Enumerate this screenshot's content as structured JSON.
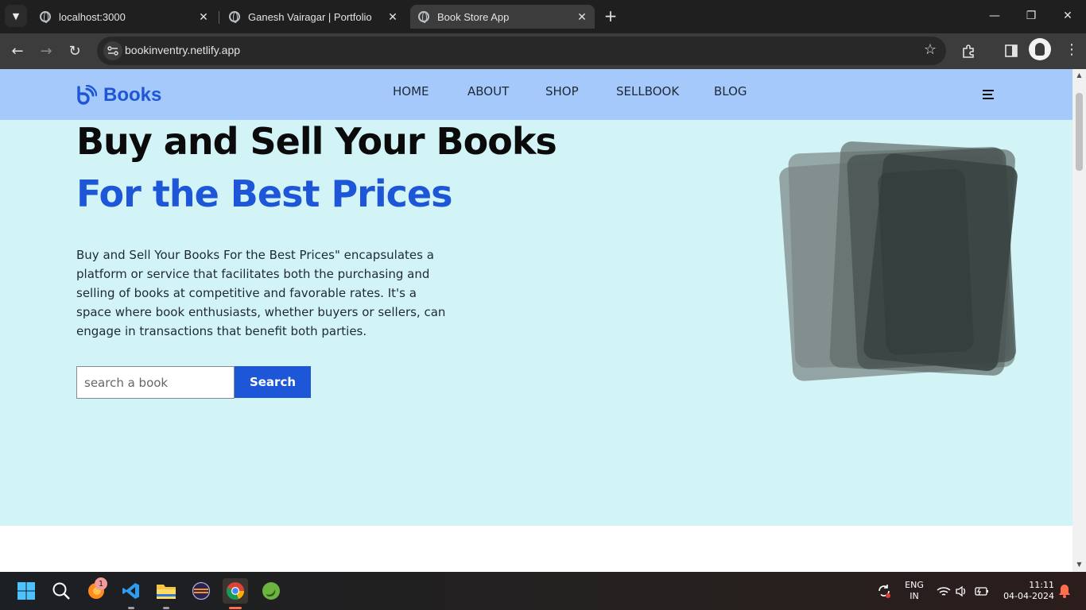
{
  "browser": {
    "tabs": [
      {
        "title": "localhost:3000",
        "active": false
      },
      {
        "title": "Ganesh Vairagar | Portfolio",
        "active": false
      },
      {
        "title": "Book Store App",
        "active": true
      }
    ],
    "url": "bookinventry.netlify.app"
  },
  "site": {
    "brand": "Books",
    "nav": [
      "HOME",
      "ABOUT",
      "SHOP",
      "SELLBOOK",
      "BLOG"
    ],
    "hero": {
      "title": "Buy and Sell Your Books",
      "subtitle": "For the Best Prices",
      "description": "Buy and Sell Your Books For the Best Prices\" encapsulates a platform or service that facilitates both the purchasing and selling of books at competitive and favorable rates. It's a space where book enthusiasts, whether buyers or sellers, can engage in transactions that benefit both parties.",
      "search_placeholder": "search a book",
      "search_button": "Search"
    },
    "colors": {
      "nav_bg": "#a6c9fb",
      "hero_bg": "#d3f4f6",
      "accent": "#1d56d6"
    }
  },
  "taskbar": {
    "notification_count": "1",
    "language": "ENG",
    "region": "IN",
    "time": "11:11",
    "date": "04-04-2024"
  }
}
